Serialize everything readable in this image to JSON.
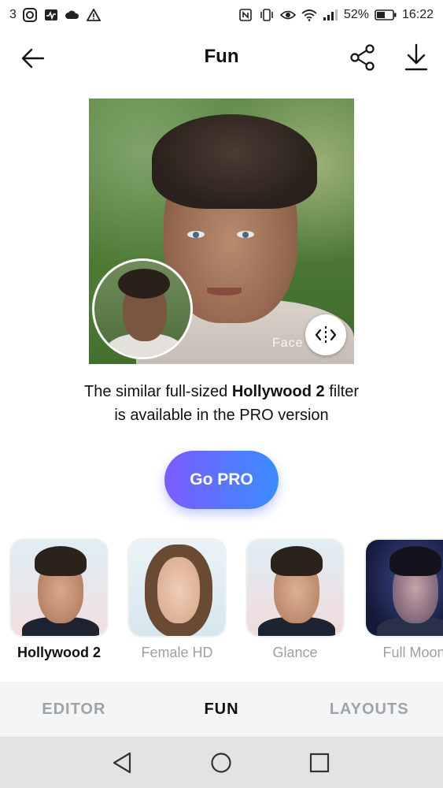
{
  "status_bar": {
    "left_text": "3",
    "battery": "52%",
    "time": "16:22",
    "icons_left": [
      "instagram-icon",
      "activity-icon",
      "cloud-icon",
      "warning-icon"
    ],
    "icons_right": [
      "nfc-icon",
      "vibrate-icon",
      "eye-icon",
      "wifi-icon",
      "signal-icon",
      "battery-icon"
    ]
  },
  "header": {
    "title": "Fun",
    "back_icon": "arrow-left-icon",
    "share_icon": "share-icon",
    "download_icon": "download-icon"
  },
  "preview": {
    "watermark": "Face",
    "compare_icon": "compare-slider-icon"
  },
  "promo": {
    "line1_prefix": "The similar full-sized ",
    "filter_name": "Hollywood 2",
    "line1_suffix": " filter",
    "line2": "is available in the PRO version"
  },
  "go_pro": {
    "label": "Go PRO"
  },
  "filters": [
    {
      "label": "Hollywood 2",
      "active": true
    },
    {
      "label": "Female HD",
      "active": false
    },
    {
      "label": "Glance",
      "active": false
    },
    {
      "label": "Full Moon",
      "active": false
    }
  ],
  "tabs": [
    {
      "label": "EDITOR",
      "active": false
    },
    {
      "label": "FUN",
      "active": true
    },
    {
      "label": "LAYOUTS",
      "active": false
    }
  ],
  "nav": {
    "back_icon": "nav-back-icon",
    "home_icon": "nav-home-icon",
    "recents_icon": "nav-recents-icon"
  },
  "colors": {
    "accent_start": "#7b5cff",
    "accent_end": "#3b8cff",
    "inactive_tab": "#9aa4ad"
  }
}
